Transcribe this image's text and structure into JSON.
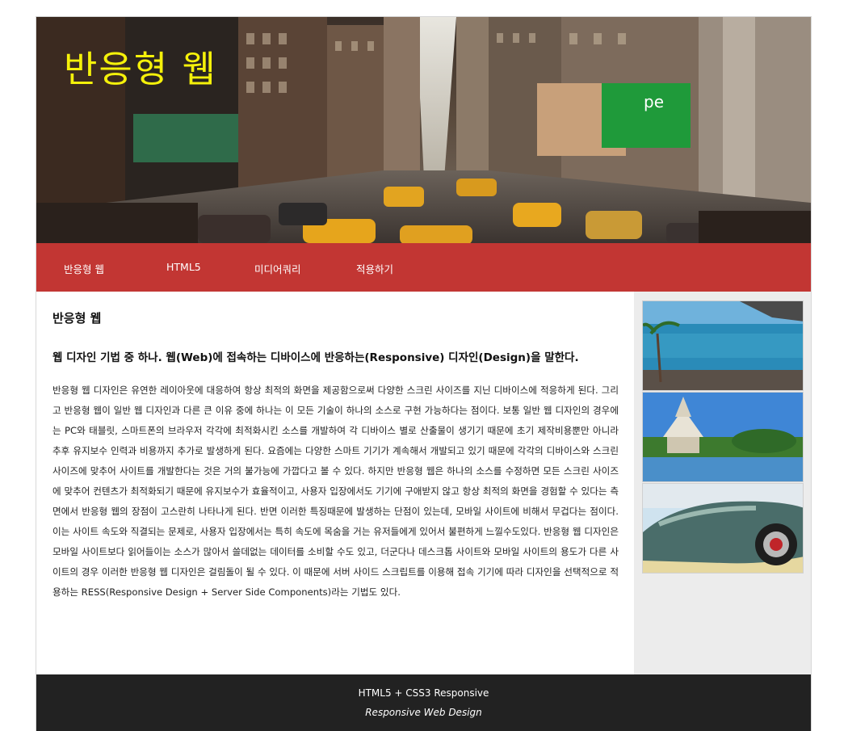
{
  "header": {
    "title": "반응형 웹",
    "title_color": "#f5f10a"
  },
  "nav": {
    "background": "#c23633",
    "items": [
      {
        "label": "반응형 웹"
      },
      {
        "label": "HTML5"
      },
      {
        "label": "미디어쿼리"
      },
      {
        "label": "적용하기"
      }
    ]
  },
  "main": {
    "heading": "반응형 웹",
    "subheading": "웹 디자인 기법 중 하나. 웹(Web)에 접속하는 디바이스에 반응하는(Responsive) 디자인(Design)을 말한다.",
    "body": "반응형 웹 디자인은 유연한 레이아웃에 대응하여 항상 최적의 화면을 제공함으로써 다양한 스크린 사이즈를 지닌 디바이스에 적응하게 된다. 그리고 반응형 웹이 일반 웹 디자인과 다른 큰 이유 중에 하나는 이 모든 기술이 하나의 소스로 구현 가능하다는 점이다. 보통 일반 웹 디자인의 경우에는 PC와 태블릿, 스마트폰의 브라우저 각각에 최적화시킨 소스를 개발하여 각 디바이스 별로 산출물이 생기기 때문에 초기 제작비용뿐만 아니라 추후 유지보수 인력과 비용까지 추가로 발생하게 된다. 요즘에는 다양한 스마트 기기가 계속해서 개발되고 있기 때문에 각각의 디바이스와 스크린 사이즈에 맞추어 사이트를 개발한다는 것은 거의 불가능에 가깝다고 볼 수 있다. 하지만 반응형 웹은 하나의 소스를 수정하면 모든 스크린 사이즈에 맞추어 컨텐츠가 최적화되기 때문에 유지보수가 효율적이고, 사용자 입장에서도 기기에 구애받지 않고 항상 최적의 화면을 경험할 수 있다는 측면에서 반응형 웹의 장점이 고스란히 나타나게 된다. 반면 이러한 특징때문에 발생하는 단점이 있는데, 모바일 사이트에 비해서 무겁다는 점이다. 이는 사이트 속도와 직결되는 문제로, 사용자 입장에서는 특히 속도에 목숨을 거는 유저들에게 있어서 불편하게 느낄수도있다. 반응형 웹 디자인은 모바일 사이트보다 읽어들이는 소스가 많아서 쓸데없는 데이터를 소비할 수도 있고, 더군다나 데스크톱 사이트와 모바일 사이트의 용도가 다른 사이트의 경우 이러한 반응형 웹 디자인은 걸림돌이 될 수 있다. 이 때문에 서버 사이드 스크립트를 이용해 접속 기기에 따라 디자인을 선택적으로 적용하는 RESS(Responsive Design + Server Side Components)라는 기법도 있다."
  },
  "aside": {
    "images": [
      {
        "name": "beach-photo"
      },
      {
        "name": "temple-photo"
      },
      {
        "name": "sports-car-photo"
      }
    ]
  },
  "footer": {
    "line1": "HTML5 + CSS3 Responsive",
    "line2": "Responsive Web Design",
    "background": "#222222"
  }
}
